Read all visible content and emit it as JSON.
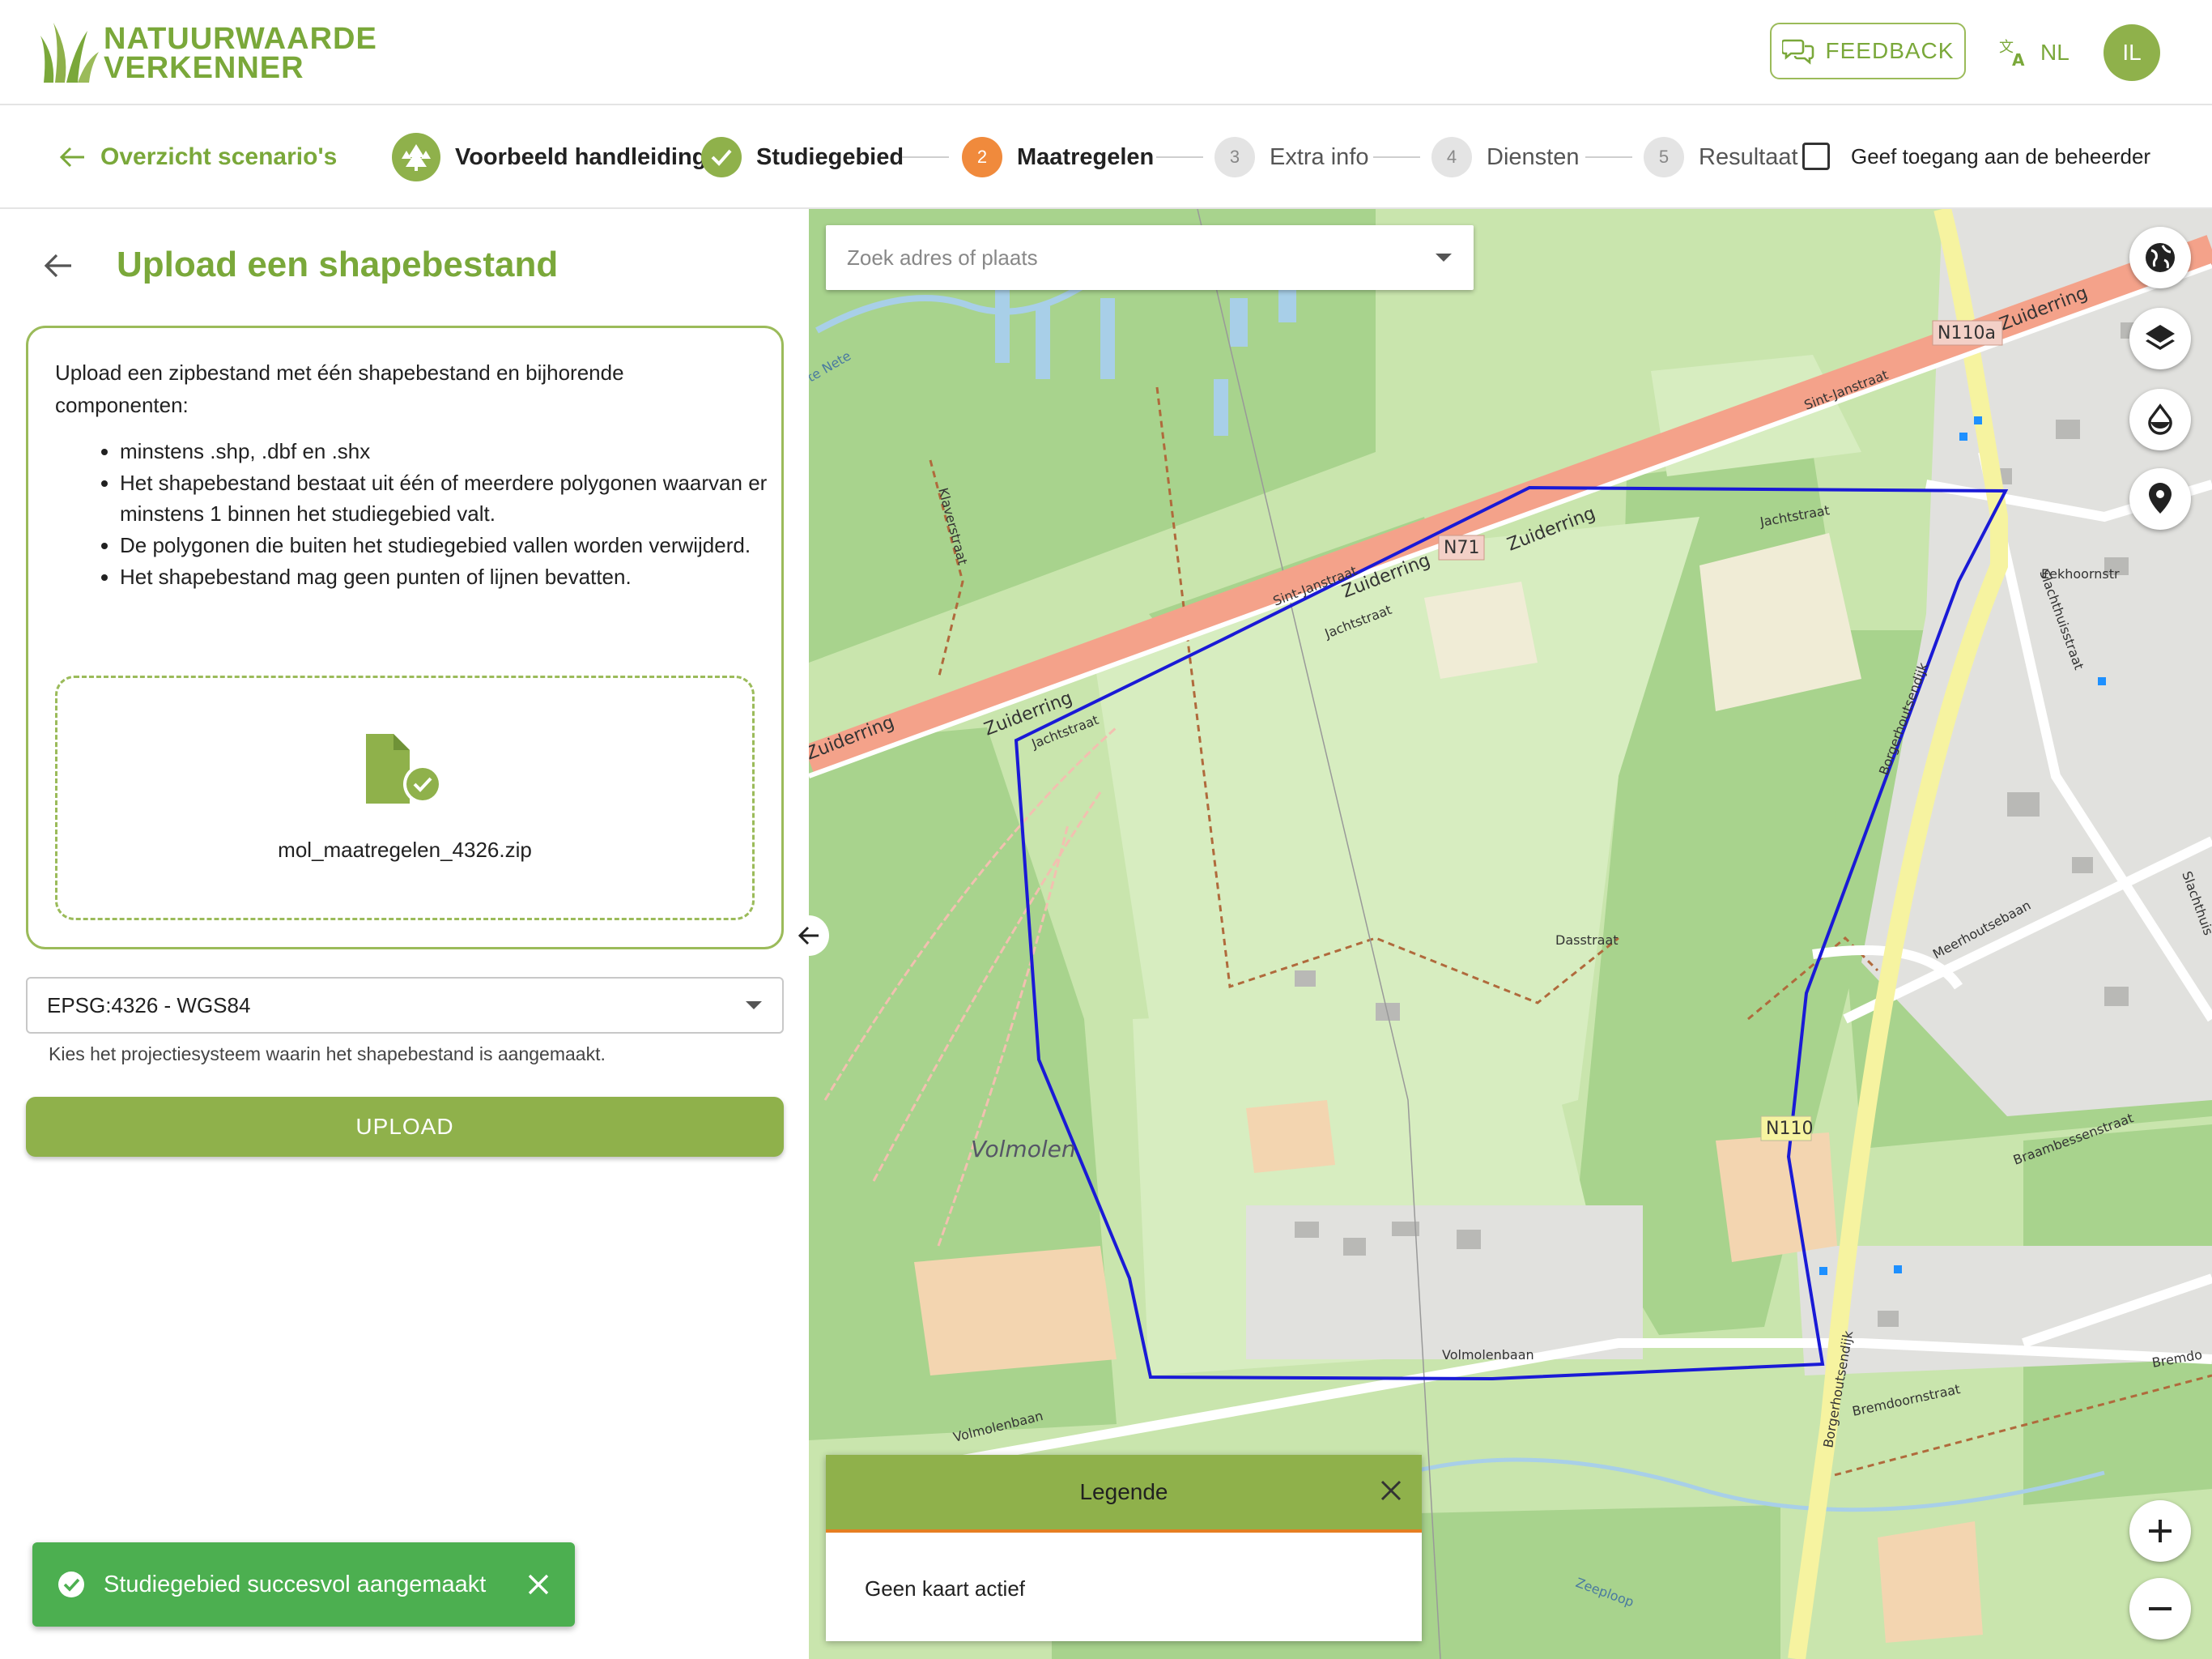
{
  "header": {
    "logo_line1": "NATUURWAARDE",
    "logo_line2": "VERKENNER",
    "feedback_label": "FEEDBACK",
    "language": "NL",
    "avatar_initials": "IL"
  },
  "stepper": {
    "back_label": "Overzicht scenario's",
    "steps": [
      {
        "label": "Voorbeeld handleiding",
        "state": "done-icon"
      },
      {
        "label": "Studiegebied",
        "state": "done"
      },
      {
        "label": "Maatregelen",
        "number": "2",
        "state": "active"
      },
      {
        "label": "Extra info",
        "number": "3",
        "state": "todo"
      },
      {
        "label": "Diensten",
        "number": "4",
        "state": "todo"
      },
      {
        "label": "Resultaat",
        "number": "5",
        "state": "todo"
      }
    ],
    "checkbox_label": "Geef toegang aan de beheerder"
  },
  "panel": {
    "title": "Upload een shapebestand",
    "intro": "Upload een zipbestand met één shapebestand en bijhorende componenten:",
    "bullets": [
      "minstens .shp, .dbf en .shx",
      "Het shapebestand bestaat uit één of meerdere polygonen waarvan er minstens 1 binnen het studiegebied valt.",
      "De polygonen die buiten het studiegebied vallen worden verwijderd.",
      "Het shapebestand mag geen punten of lijnen bevatten."
    ],
    "filename": "mol_maatregelen_4326.zip",
    "projection_value": "EPSG:4326 - WGS84",
    "projection_hint": "Kies het projectiesysteem waarin het shapebestand is aangemaakt.",
    "upload_label": "UPLOAD"
  },
  "toast": {
    "message": "Studiegebied succesvol aangemaakt"
  },
  "map": {
    "search_placeholder": "Zoek adres of plaats",
    "labels": {
      "n110a": "N110a",
      "zuiderring": "Zuiderring",
      "sintjanstraat": "Sint-Janstraat",
      "n71": "N71",
      "jachtstraat": "Jachtstraat",
      "klaverstraat": "Klaverstraat",
      "volmolen": "Volmolen",
      "volmolenbaan": "Volmolenbaan",
      "dasstraat": "Dasstraat",
      "meerhoutsebaan": "Meerhoutsebaan",
      "n110": "N110",
      "borgerhoutsendijk": "Borgerhoutsendijk",
      "bremdoornstraat": "Bremdoornstraat",
      "braambessenstraat": "Braambessenstraat",
      "eekhoornstr": "Eekhoornstr",
      "zeeploop": "Zeeploop",
      "slachthuisstraat": "Slachthuisstraat",
      "slachthuis": "Slachthuis",
      "bremdo": "Bremdo",
      "nete": "te Nete"
    },
    "legend_title": "Legende",
    "legend_empty": "Geen kaart actief"
  },
  "colors": {
    "brand_green": "#8fb14b",
    "brand_text_green": "#7aa83a",
    "step_active": "#f08a3c",
    "polygon": "#1a1ad6",
    "toast": "#4caf50"
  }
}
